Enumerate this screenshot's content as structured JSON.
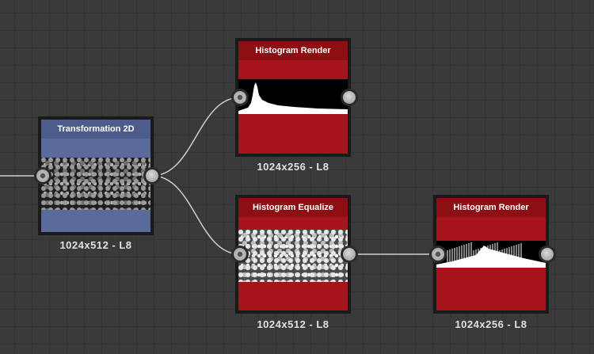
{
  "graph": {
    "nodes": [
      {
        "id": "transformation_2d",
        "title": "Transformation 2D",
        "label": "1024x512 - L8",
        "theme": "blue"
      },
      {
        "id": "histogram_render_1",
        "title": "Histogram Render",
        "label": "1024x256 - L8",
        "theme": "red"
      },
      {
        "id": "histogram_equalize",
        "title": "Histogram Equalize",
        "label": "1024x512 - L8",
        "theme": "red"
      },
      {
        "id": "histogram_render_2",
        "title": "Histogram Render",
        "label": "1024x256 - L8",
        "theme": "red"
      }
    ]
  },
  "icons": {
    "port_input": "input-port-icon",
    "port_output": "output-port-icon"
  },
  "colors": {
    "canvas": "#3a3a3a",
    "node_red": "#a5141a",
    "node_red_title": "#8d0f13",
    "node_blue": "#5b6a9b",
    "node_blue_title": "#4e5c8c"
  }
}
